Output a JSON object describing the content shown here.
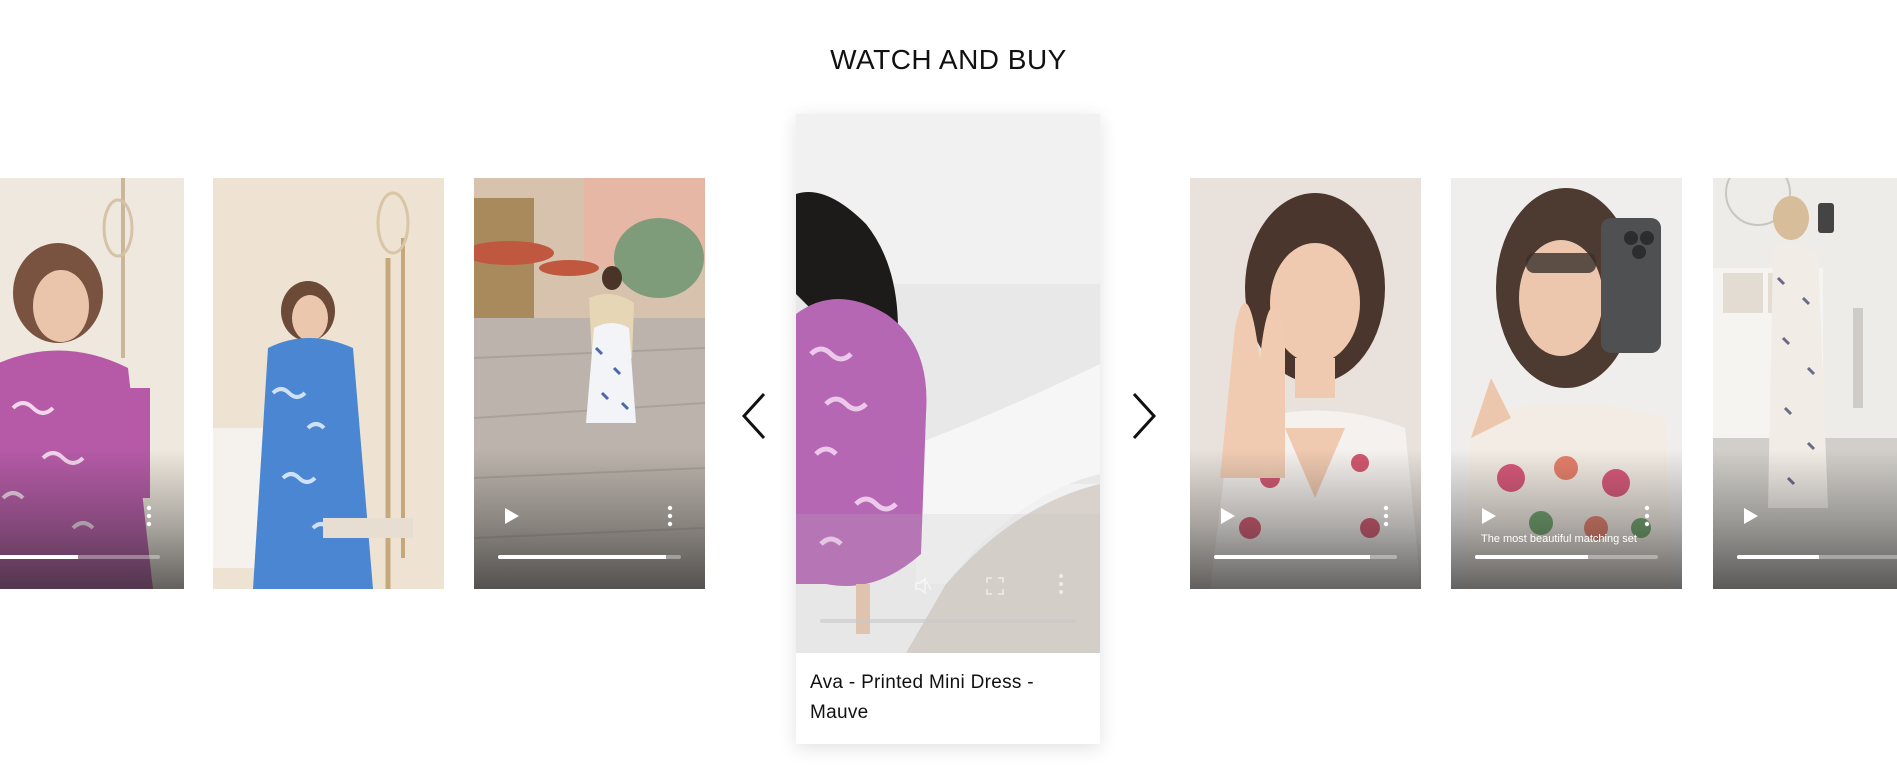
{
  "section": {
    "title": "WATCH AND BUY"
  },
  "featured": {
    "product_name": "Ava - Printed Mini Dress - Mauve"
  },
  "cards": [
    {
      "id": "card-1",
      "progress": 0.55,
      "caption": ""
    },
    {
      "id": "card-2",
      "progress": null,
      "caption": ""
    },
    {
      "id": "card-3",
      "progress": 0.92,
      "caption": ""
    },
    {
      "id": "card-4",
      "progress": 0.85,
      "caption": ""
    },
    {
      "id": "card-5",
      "progress": 0.62,
      "caption": "The most beautiful matching set"
    },
    {
      "id": "card-6",
      "progress": 0.45,
      "caption": ""
    }
  ],
  "icons": {
    "prev": "chevron-left-icon",
    "next": "chevron-right-icon",
    "play": "play-icon",
    "more": "more-vertical-icon"
  },
  "colors": {
    "background": "#ffffff",
    "title": "#111111",
    "overlay": "#3c3c3c"
  }
}
